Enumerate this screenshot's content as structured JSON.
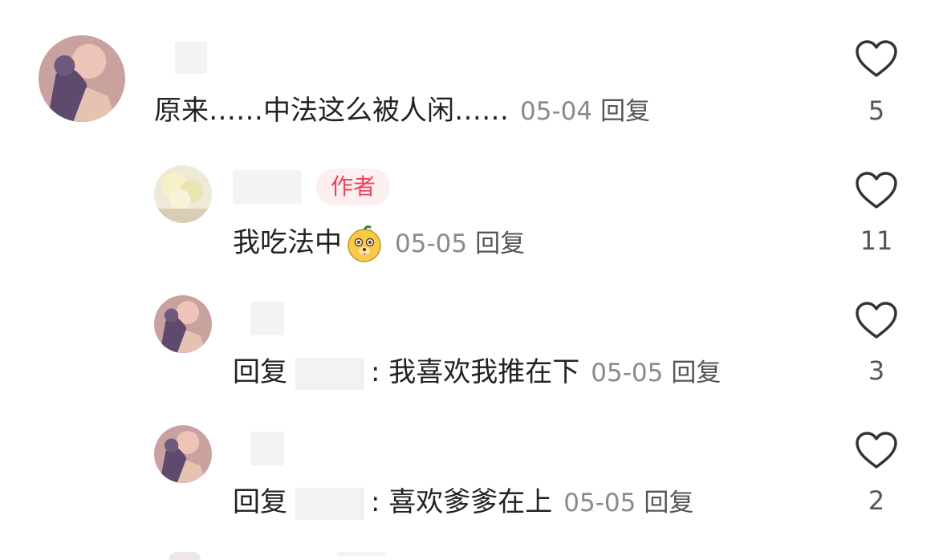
{
  "comments": [
    {
      "text": "原来……中法这么被人闲……",
      "date": "05-04",
      "reply_label": "回复",
      "likes": "5"
    },
    {
      "badge": "作者",
      "text": "我吃法中",
      "date": "05-05",
      "reply_label": "回复",
      "likes": "11",
      "emoji": "dog-face-emoji"
    },
    {
      "prefix": "回复",
      "text": ": 我喜欢我推在下",
      "date": "05-05",
      "reply_label": "回复",
      "likes": "3"
    },
    {
      "prefix": "回复",
      "text": ": 喜欢爹爹在上",
      "date": "05-05",
      "reply_label": "回复",
      "likes": "2"
    }
  ],
  "colors": {
    "badge_bg": "#fdeef0",
    "badge_text": "#e8455b",
    "date": "#8a8a8a"
  },
  "icons": {
    "like": "heart-outline-icon"
  }
}
